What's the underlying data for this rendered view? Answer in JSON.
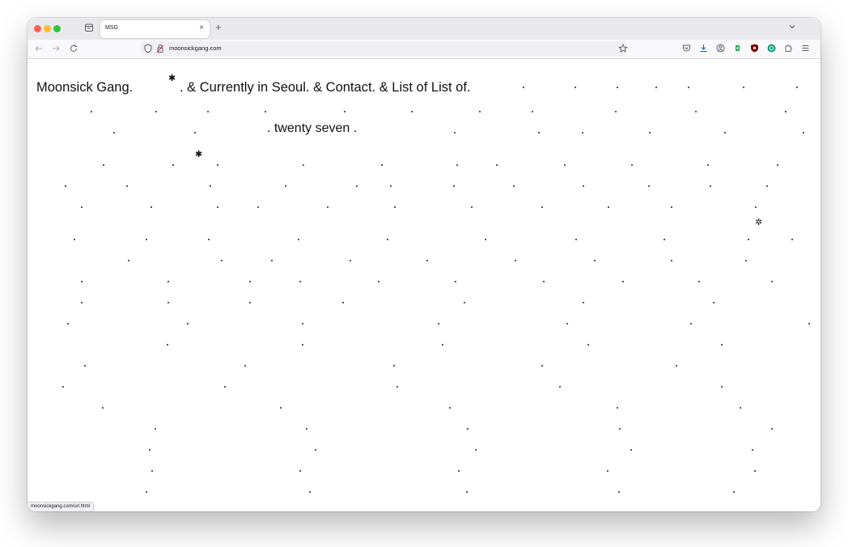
{
  "browser": {
    "tab_title": "MSG",
    "tab_close": "×",
    "new_tab": "+",
    "url": "moonsickgang.com",
    "status_url": "moonsickgang.com/url.html"
  },
  "page": {
    "brand": "Moonsick Gang.",
    "nav": ". & Currently in Seoul. & Contact. & List of List of.",
    "subtitle": ". twenty seven ."
  },
  "icons": {
    "spider": "✱",
    "beetle": "✲"
  }
}
